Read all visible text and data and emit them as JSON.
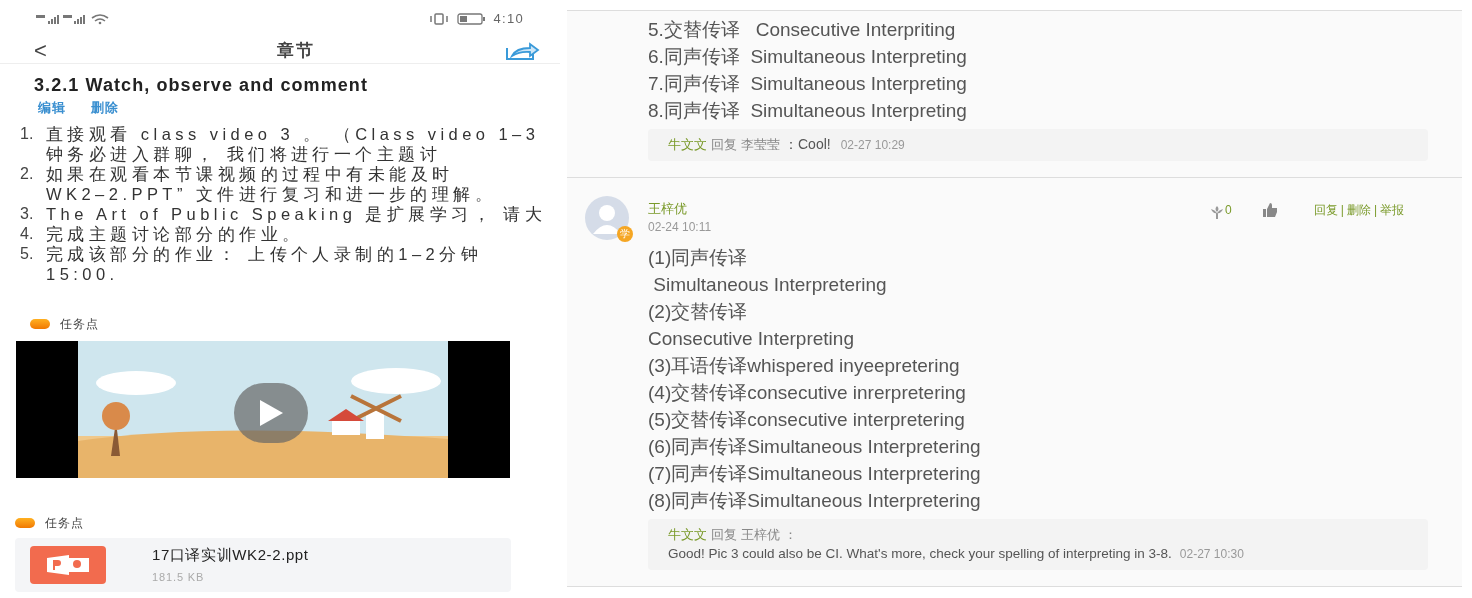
{
  "phone": {
    "status_bar": {
      "time": "4:10"
    },
    "nav": {
      "back": "<",
      "title": "章节"
    },
    "section_title": "3.2.1 Watch, observe and comment",
    "actions": [
      "编辑",
      "删除"
    ],
    "instructions": [
      {
        "number": "1.",
        "lines": [
          "直接观看 class video 3 。 （Class video 1–3",
          "钟务必进入群聊， 我们将进行一个主题讨"
        ]
      },
      {
        "number": "2.",
        "lines": [
          "如果在观看本节课视频的过程中有未能及时",
          "WK2–2.PPT” 文件进行复习和进一步的理解。"
        ]
      },
      {
        "number": "3.",
        "lines": [
          "The Art of Public Speaking 是扩展学习， 请大"
        ]
      },
      {
        "number": "4.",
        "lines": [
          "完成主题讨论部分的作业。"
        ]
      },
      {
        "number": "5.",
        "lines": [
          "完成该部分的作业： 上传个人录制的1–2分钟",
          "15:00."
        ]
      }
    ],
    "task_points": [
      {
        "kind": "video",
        "label": "任务点"
      },
      {
        "kind": "file",
        "label": "任务点",
        "file_name": "17口译实训WK2-2.ppt",
        "file_size": "181.5 KB"
      }
    ]
  },
  "discussion": {
    "previous_comment": {
      "lines": [
        "5.交替传译   Consecutive Interpriting",
        "6.同声传译  Simultaneous Interpreting",
        "7.同声传译  Simultaneous Interpreting",
        "8.同声传译  Simultaneous Interpreting"
      ],
      "reply": {
        "author": "牛文文",
        "verb": "回复",
        "target": "李莹莹",
        "text": "：Cool!",
        "time": "02-27 10:29"
      }
    },
    "comment": {
      "author": "王梓优",
      "badge": "学",
      "time": "02-24 10:11",
      "flower_count": "0",
      "actions": [
        "回复",
        "删除",
        "举报"
      ],
      "action_separator": "|",
      "lines": [
        "(1)同声传译",
        " Simultaneous Interpretering",
        "(2)交替传译",
        "Consecutive Interpreting",
        "(3)耳语传译whispered inyeepretering",
        "(4)交替传译consecutive inrerpretering",
        "(5)交替传译consecutive interpretering",
        "(6)同声传译Simultaneous Interpretering",
        "(7)同声传译Simultaneous Interpretering",
        "(8)同声传译Simultaneous Interpretering"
      ],
      "reply": {
        "author": "牛文文",
        "verb": "回复",
        "target": "王梓优",
        "header_suffix": "：",
        "text": "Good! Pic 3 could also be CI. What's more, check your spelling of interpreting in 3-8.",
        "time": "02-27 10:30"
      }
    }
  }
}
